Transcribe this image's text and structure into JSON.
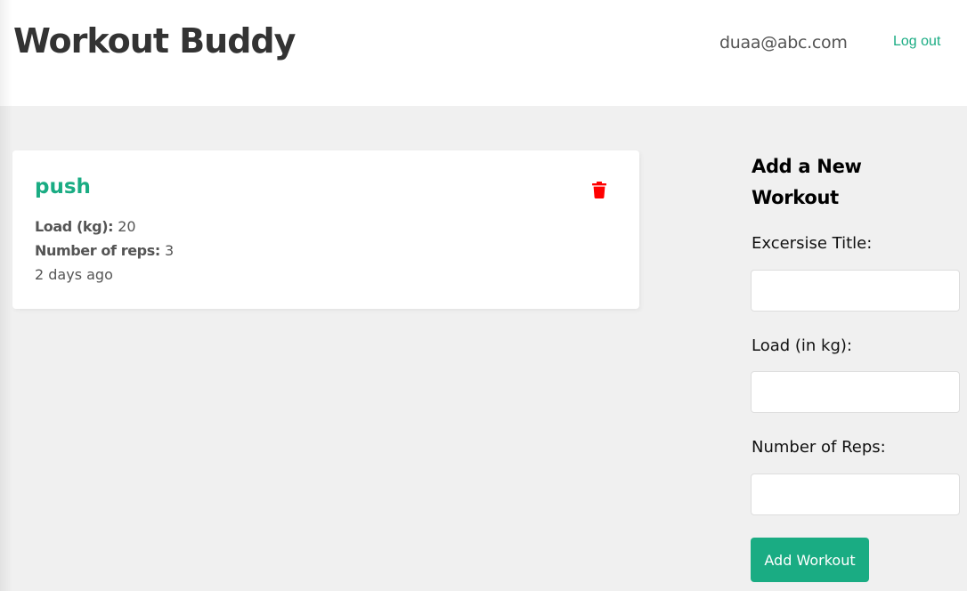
{
  "header": {
    "title": "Workout Buddy",
    "user_email": "duaa@abc.com",
    "logout_label": "Log out"
  },
  "workouts": [
    {
      "title": "push",
      "load_label": "Load (kg):",
      "load_value": "20",
      "reps_label": "Number of reps:",
      "reps_value": "3",
      "created": "2 days ago",
      "delete_icon": "trash-icon"
    }
  ],
  "form": {
    "heading": "Add a New Workout",
    "title_label": "Excersise Title:",
    "title_value": "",
    "load_label": "Load (in kg):",
    "load_value": "",
    "reps_label": "Number of Reps:",
    "reps_value": "",
    "submit_label": "Add Workout"
  },
  "colors": {
    "accent": "#1aac83",
    "delete": "#ff0000",
    "background": "#f0f0f0",
    "text": "#333333"
  }
}
